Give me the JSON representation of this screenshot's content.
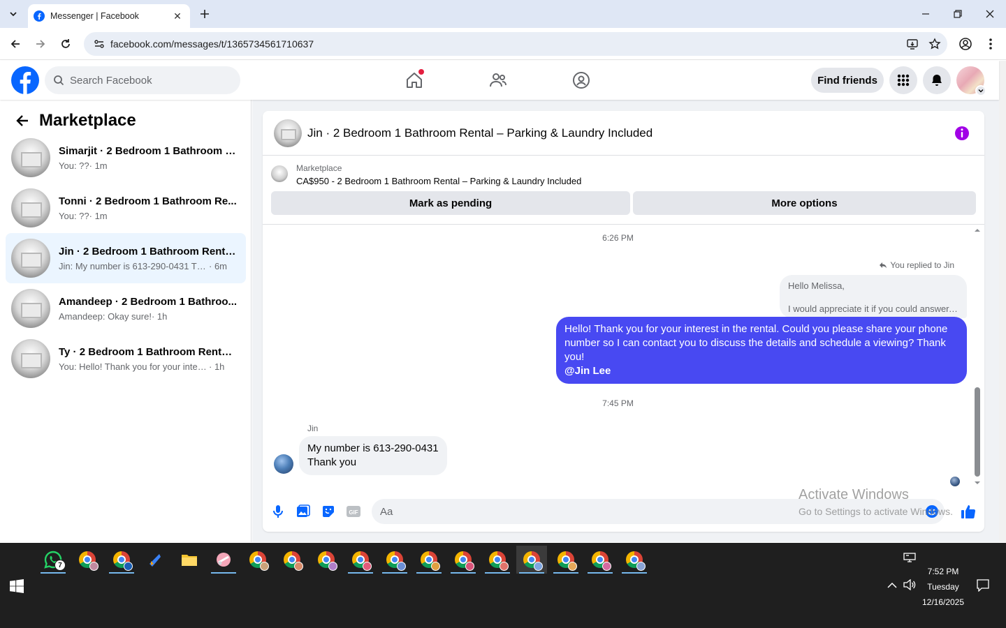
{
  "browser": {
    "tab_title": "Messenger | Facebook",
    "url": "facebook.com/messages/t/1365734561710637",
    "new_tab_label": "+",
    "close_tab_label": "✕"
  },
  "fb_header": {
    "search_placeholder": "Search Facebook",
    "find_friends_label": "Find friends",
    "brand_color": "#0866ff"
  },
  "marketplace": {
    "title": "Marketplace",
    "conversations": [
      {
        "name": "Simarjit · 2 Bedroom 1 Bathroom R...",
        "snippet": "You: ??",
        "time": " · 1m",
        "active": false
      },
      {
        "name": "Tonni · 2 Bedroom 1 Bathroom Re...",
        "snippet": "You: ??",
        "time": " · 1m",
        "active": false
      },
      {
        "name": "Jin · 2 Bedroom 1 Bathroom Rental...",
        "snippet": "Jin: My number is 613-290-0431 Tha...",
        "time": " · 6m",
        "active": true
      },
      {
        "name": "Amandeep · 2 Bedroom 1 Bathroo...",
        "snippet": "Amandeep: Okay sure!",
        "time": " · 1h",
        "active": false
      },
      {
        "name": "Ty · 2 Bedroom 1 Bathroom Rental ...",
        "snippet": "You: Hello! Thank you for your interes...",
        "time": " · 1h",
        "active": false
      }
    ]
  },
  "chat": {
    "title": "Jin · 2 Bedroom 1 Bathroom Rental – Parking & Laundry Included",
    "listing_label": "Marketplace",
    "listing_price_title": "CA$950 - 2 Bedroom 1 Bathroom Rental – Parking & Laundry Included",
    "mark_pending_label": "Mark as pending",
    "more_options_label": "More options",
    "timestamp_1": "6:26 PM",
    "replied_label": "You replied to Jin",
    "quoted_line_1": "Hello Melissa,",
    "quoted_line_2": "I would appreciate it if you could answer....",
    "sent_message": "Hello! Thank you for your interest in the rental. Could you please share your phone number so I can contact you to discuss the details and schedule a viewing? Thank you!",
    "sent_mention": "@Jin Lee",
    "timestamp_2": "7:45 PM",
    "incoming_sender": "Jin",
    "incoming_line_1": "My number is 613-290-0431",
    "incoming_line_2": "Thank you",
    "composer_placeholder": "Aa",
    "accent_color": "#4849f2"
  },
  "watermark": {
    "line1": "Activate Windows",
    "line2": "Go to Settings to activate Windows."
  },
  "taskbar": {
    "whatsapp_badge": "7",
    "time": "7:52 PM",
    "day": "Tuesday",
    "date": "12/16/2025"
  }
}
